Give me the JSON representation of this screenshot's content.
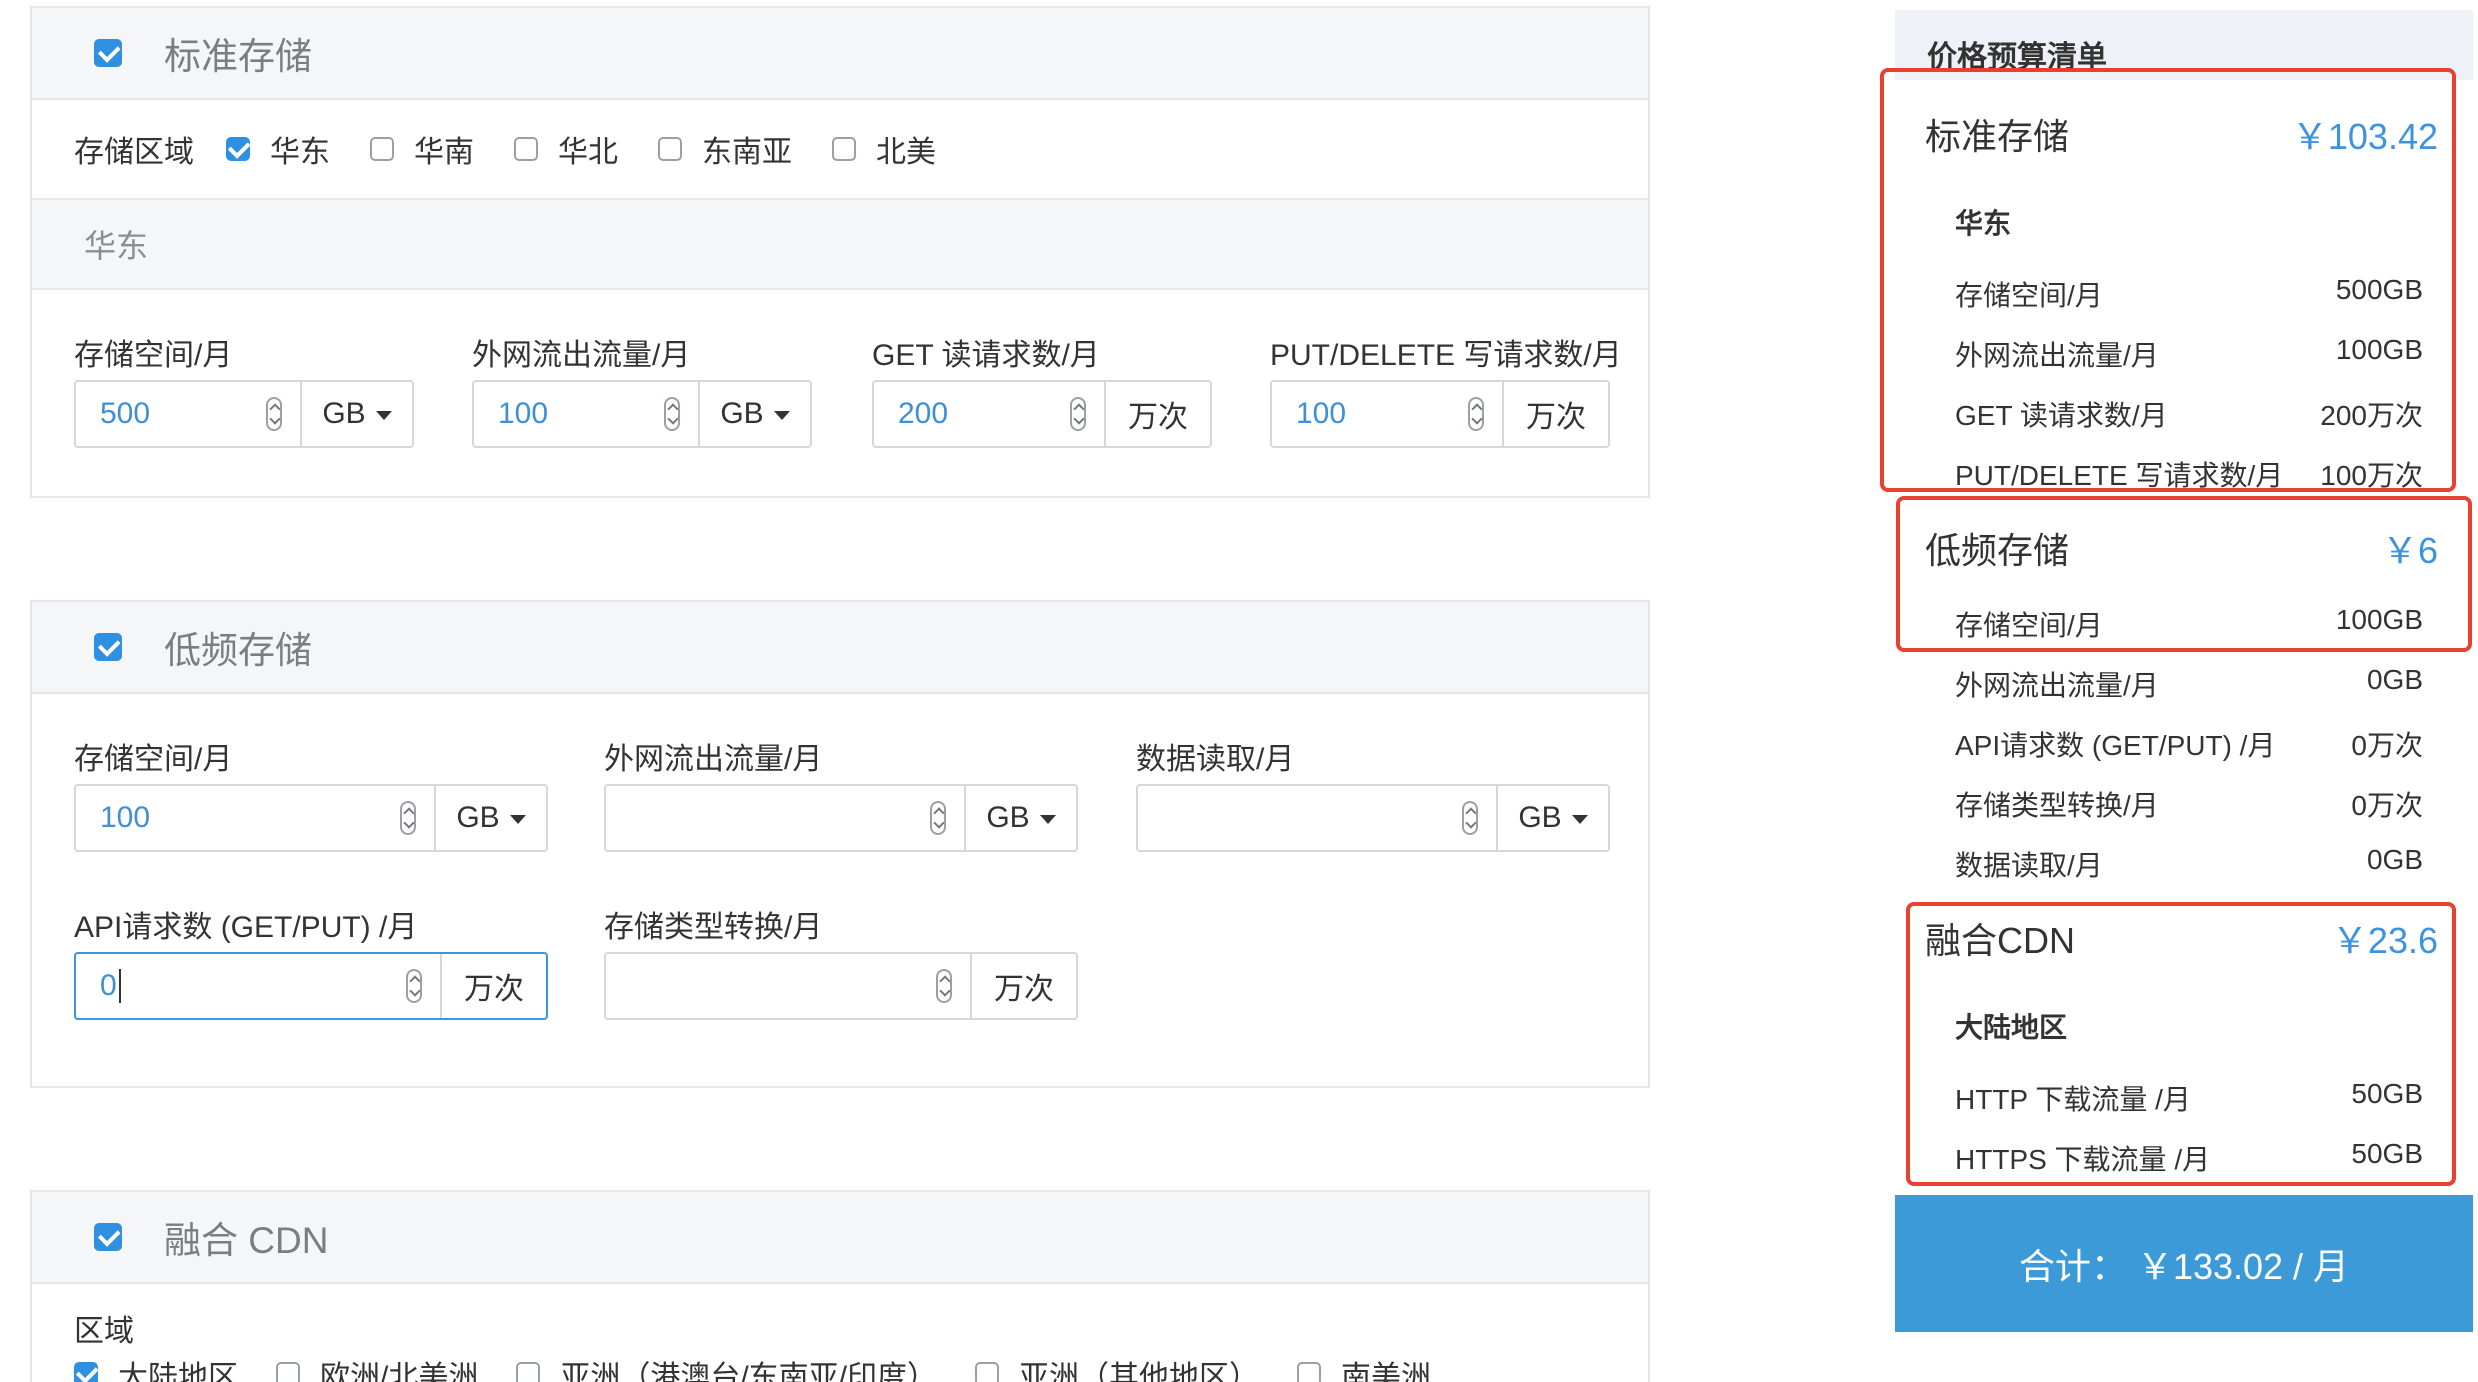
{
  "standard": {
    "title": "标准存储",
    "region_label": "存储区域",
    "regions": [
      "华东",
      "华南",
      "华北",
      "东南亚",
      "北美"
    ],
    "sub_title": "华东",
    "fields": [
      {
        "label": "存储空间/月",
        "value": "500",
        "unit": "GB"
      },
      {
        "label": "外网流出流量/月",
        "value": "100",
        "unit": "GB"
      },
      {
        "label": "GET 读请求数/月",
        "value": "200",
        "unit": "万次"
      },
      {
        "label": "PUT/DELETE 写请求数/月",
        "value": "100",
        "unit": "万次"
      }
    ]
  },
  "lowfreq": {
    "title": "低频存储",
    "fields": [
      {
        "label": "存储空间/月",
        "value": "100",
        "unit": "GB"
      },
      {
        "label": "外网流出流量/月",
        "value": "",
        "unit": "GB"
      },
      {
        "label": "数据读取/月",
        "value": "",
        "unit": "GB"
      },
      {
        "label": "API请求数 (GET/PUT) /月",
        "value": "0",
        "unit": "万次"
      },
      {
        "label": "存储类型转换/月",
        "value": "",
        "unit": "万次"
      }
    ]
  },
  "cdn": {
    "title": "融合 CDN",
    "region_label": "区域",
    "regions": [
      "大陆地区",
      "欧洲/北美洲",
      "亚洲（港澳台/东南亚/印度）",
      "亚洲（其他地区）",
      "南美洲"
    ]
  },
  "summary": {
    "title": "价格预算清单",
    "standard": {
      "title": "标准存储",
      "price": "￥103.42",
      "sub": "华东",
      "rows": [
        {
          "label": "存储空间/月",
          "value": "500GB"
        },
        {
          "label": "外网流出流量/月",
          "value": "100GB"
        },
        {
          "label": "GET 读请求数/月",
          "value": "200万次"
        },
        {
          "label": "PUT/DELETE 写请求数/月",
          "value": "100万次"
        }
      ]
    },
    "lowfreq": {
      "title": "低频存储",
      "price": "￥6",
      "rows": [
        {
          "label": "存储空间/月",
          "value": "100GB"
        },
        {
          "label": "外网流出流量/月",
          "value": "0GB"
        },
        {
          "label": "API请求数 (GET/PUT) /月",
          "value": "0万次"
        },
        {
          "label": "存储类型转换/月",
          "value": "0万次"
        },
        {
          "label": "数据读取/月",
          "value": "0GB"
        }
      ]
    },
    "cdn": {
      "title": "融合CDN",
      "price": "￥23.6",
      "sub": "大陆地区",
      "rows": [
        {
          "label": "HTTP 下载流量 /月",
          "value": "50GB"
        },
        {
          "label": "HTTPS 下载流量 /月",
          "value": "50GB"
        }
      ]
    },
    "total": "合计：  ￥133.02 / 月"
  },
  "colors": {
    "accent": "#3c9ad9",
    "highlight": "#e8412f",
    "value_text": "#3d8fd8"
  }
}
